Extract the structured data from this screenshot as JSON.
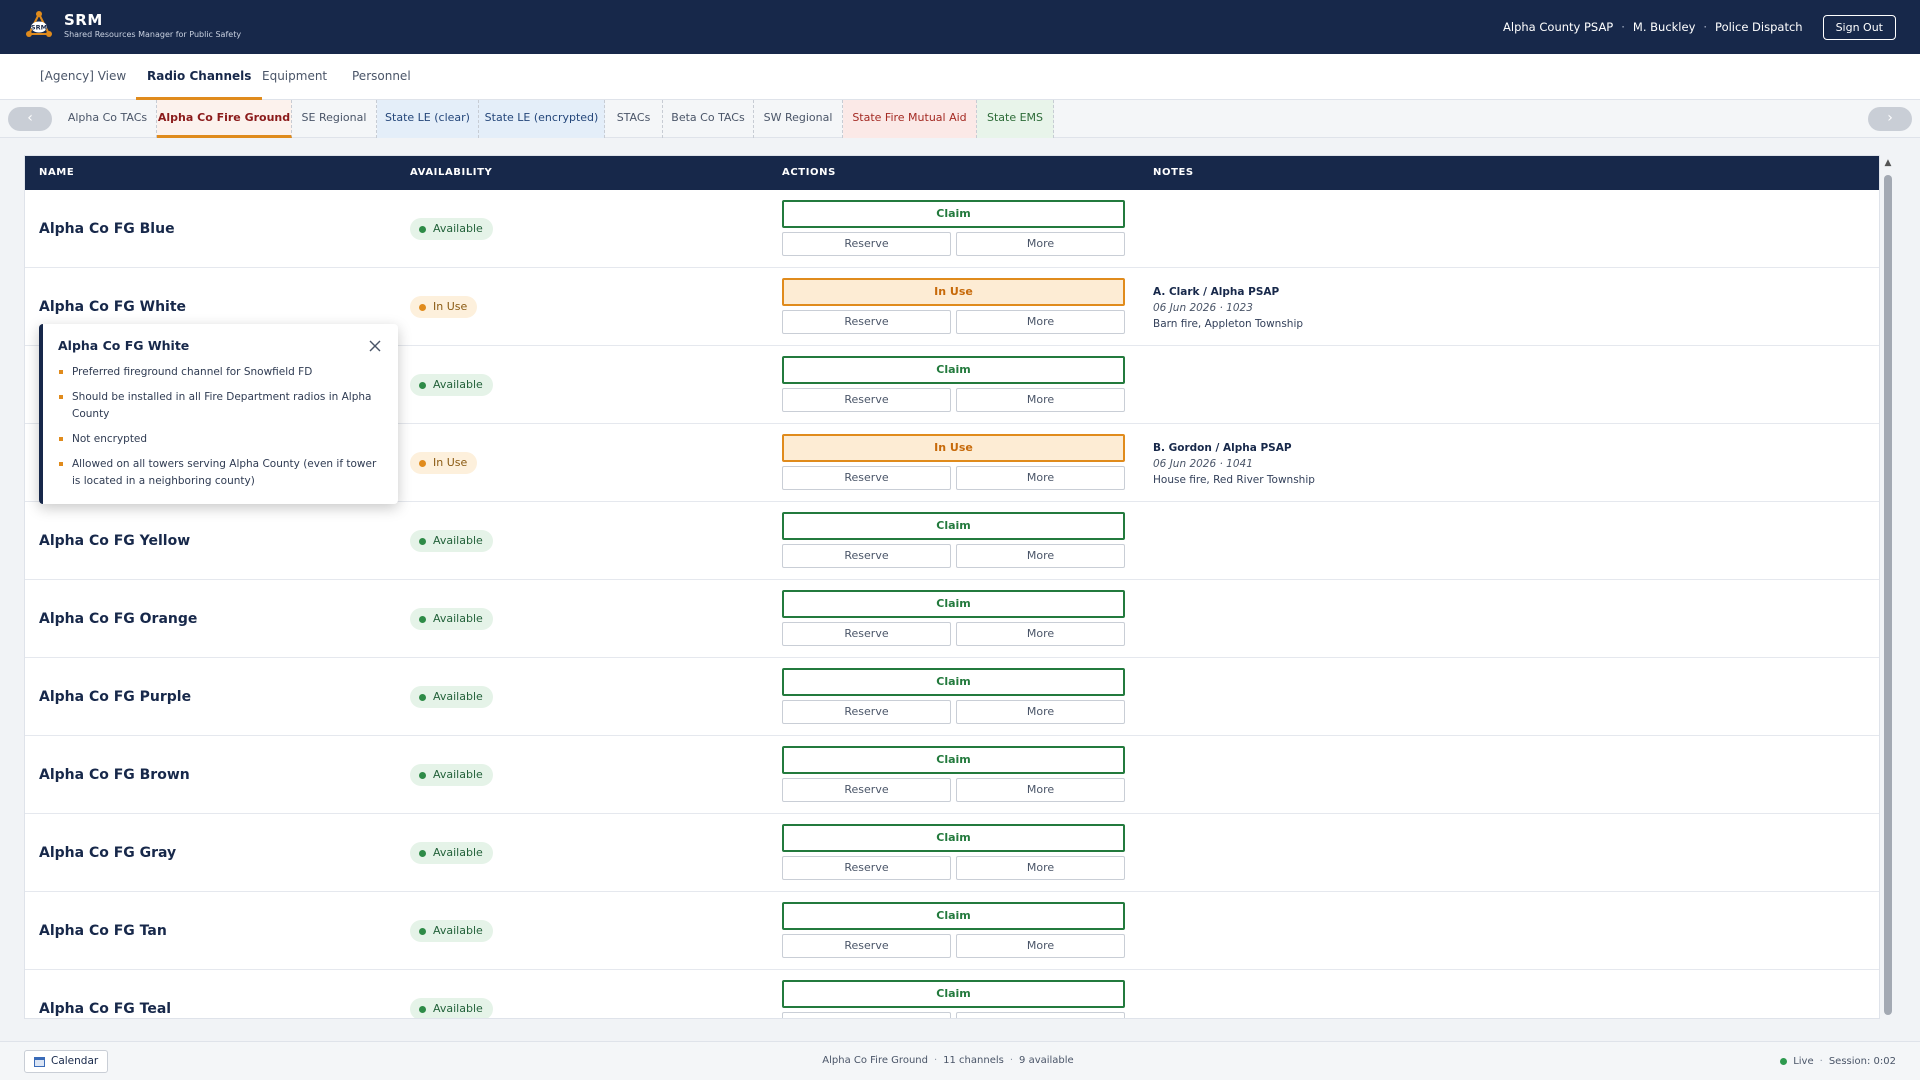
{
  "app": {
    "title": "SRM",
    "subtitle": "Shared Resources Manager for Public Safety",
    "logo_text": "SRM"
  },
  "header": {
    "agency": "Alpha County PSAP",
    "user": "M. Buckley",
    "role": "Police Dispatch",
    "separator": "·",
    "signout_label": "Sign Out"
  },
  "main_tabs": [
    {
      "label": "[Agency] View"
    },
    {
      "label": "Radio Channels"
    },
    {
      "label": "Equipment"
    },
    {
      "label": "Personnel"
    }
  ],
  "sub_tabs": {
    "prev_label": "‹",
    "next_label": "›",
    "items": [
      {
        "label": "Alpha Co TACs"
      },
      {
        "label": "Alpha Co Fire Ground"
      },
      {
        "label": "SE Regional"
      },
      {
        "label": "State LE (clear)"
      },
      {
        "label": "State LE (encrypted)"
      },
      {
        "label": "STACs"
      },
      {
        "label": "Beta Co TACs"
      },
      {
        "label": "SW Regional"
      },
      {
        "label": "State Fire Mutual Aid"
      },
      {
        "label": "State EMS"
      }
    ]
  },
  "table": {
    "headers": {
      "name": "NAME",
      "availability": "AVAILABILITY",
      "actions": "ACTIONS",
      "notes": "NOTES"
    },
    "reserve_label": "Reserve",
    "more_label": "More",
    "rows": [
      {
        "name": "Alpha Co FG Blue",
        "status": "Available",
        "action": "Claim",
        "note_who": "",
        "note_when": "",
        "note_text": ""
      },
      {
        "name": "Alpha Co FG White",
        "status": "In Use",
        "action": "In Use",
        "note_who": "A. Clark / Alpha PSAP",
        "note_when": "06 Jun 2026 · 1023",
        "note_text": "Barn fire, Appleton Township"
      },
      {
        "name": "",
        "status": "Available",
        "action": "Claim",
        "note_who": "",
        "note_when": "",
        "note_text": ""
      },
      {
        "name": "",
        "status": "In Use",
        "action": "In Use",
        "note_who": "B. Gordon / Alpha PSAP",
        "note_when": "06 Jun 2026 · 1041",
        "note_text": "House fire, Red River Township"
      },
      {
        "name": "Alpha Co FG Yellow",
        "status": "Available",
        "action": "Claim",
        "note_who": "",
        "note_when": "",
        "note_text": ""
      },
      {
        "name": "Alpha Co FG Orange",
        "status": "Available",
        "action": "Claim",
        "note_who": "",
        "note_when": "",
        "note_text": ""
      },
      {
        "name": "Alpha Co FG Purple",
        "status": "Available",
        "action": "Claim",
        "note_who": "",
        "note_when": "",
        "note_text": ""
      },
      {
        "name": "Alpha Co FG Brown",
        "status": "Available",
        "action": "Claim",
        "note_who": "",
        "note_when": "",
        "note_text": ""
      },
      {
        "name": "Alpha Co FG Gray",
        "status": "Available",
        "action": "Claim",
        "note_who": "",
        "note_when": "",
        "note_text": ""
      },
      {
        "name": "Alpha Co FG Tan",
        "status": "Available",
        "action": "Claim",
        "note_who": "",
        "note_when": "",
        "note_text": ""
      },
      {
        "name": "Alpha Co FG Teal",
        "status": "Available",
        "action": "Claim",
        "note_who": "",
        "note_when": "",
        "note_text": ""
      }
    ]
  },
  "popup": {
    "title": "Alpha Co FG White",
    "items": [
      "Preferred fireground channel for Snowfield FD",
      "Should be installed in all Fire Department radios in Alpha County",
      "Not encrypted",
      "Allowed on all towers serving Alpha County (even if tower is located in a neighboring county)"
    ]
  },
  "footer": {
    "calendar_label": "Calendar",
    "group": "Alpha Co Fire Ground",
    "separator": "·",
    "channels": "11 channels",
    "available": "9 available",
    "live_label": "Live",
    "session_label": "Session:",
    "session_time": "0:02"
  },
  "colors": {
    "navy": "#17284a",
    "accent_orange": "#e08b1c",
    "available_green": "#2e8b47",
    "claim_green": "#237a3d"
  },
  "icons": [
    "srm-logo-icon",
    "close-icon",
    "calendar-icon",
    "chevron-left-icon",
    "chevron-right-icon",
    "scroll-up-icon"
  ]
}
